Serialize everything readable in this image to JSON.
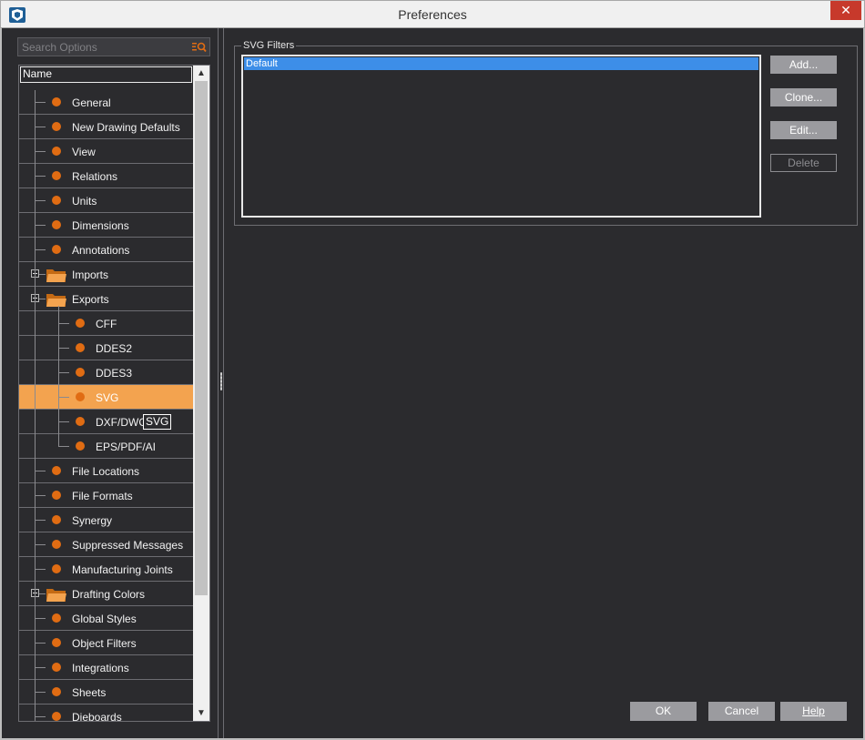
{
  "window": {
    "title": "Preferences",
    "close_glyph": "✕"
  },
  "search": {
    "placeholder": "Search Options"
  },
  "tree": {
    "header": "Name",
    "items": [
      {
        "label": "General",
        "level": 0,
        "type": "leaf"
      },
      {
        "label": "New Drawing Defaults",
        "level": 0,
        "type": "leaf"
      },
      {
        "label": "View",
        "level": 0,
        "type": "leaf"
      },
      {
        "label": "Relations",
        "level": 0,
        "type": "leaf"
      },
      {
        "label": "Units",
        "level": 0,
        "type": "leaf"
      },
      {
        "label": "Dimensions",
        "level": 0,
        "type": "leaf"
      },
      {
        "label": "Annotations",
        "level": 0,
        "type": "leaf"
      },
      {
        "label": "Imports",
        "level": 0,
        "type": "folder",
        "expanded": false
      },
      {
        "label": "Exports",
        "level": 0,
        "type": "folder",
        "expanded": true
      },
      {
        "label": "CFF",
        "level": 1,
        "type": "leaf"
      },
      {
        "label": "DDES2",
        "level": 1,
        "type": "leaf"
      },
      {
        "label": "DDES3",
        "level": 1,
        "type": "leaf"
      },
      {
        "label": "SVG",
        "level": 1,
        "type": "leaf",
        "selected": true
      },
      {
        "label": "DXF/DWG",
        "level": 1,
        "type": "leaf"
      },
      {
        "label": "EPS/PDF/AI",
        "level": 1,
        "type": "leaf"
      },
      {
        "label": "File Locations",
        "level": 0,
        "type": "leaf"
      },
      {
        "label": "File Formats",
        "level": 0,
        "type": "leaf"
      },
      {
        "label": "Synergy",
        "level": 0,
        "type": "leaf"
      },
      {
        "label": "Suppressed Messages",
        "level": 0,
        "type": "leaf"
      },
      {
        "label": "Manufacturing Joints",
        "level": 0,
        "type": "leaf"
      },
      {
        "label": "Drafting Colors",
        "level": 0,
        "type": "folder",
        "expanded": false
      },
      {
        "label": "Global Styles",
        "level": 0,
        "type": "leaf"
      },
      {
        "label": "Object Filters",
        "level": 0,
        "type": "leaf"
      },
      {
        "label": "Integrations",
        "level": 0,
        "type": "leaf"
      },
      {
        "label": "Sheets",
        "level": 0,
        "type": "leaf"
      },
      {
        "label": "Dieboards",
        "level": 0,
        "type": "leaf"
      }
    ],
    "tooltip": "SVG"
  },
  "svg_filters": {
    "group_label": "SVG Filters",
    "items": [
      "Default"
    ],
    "buttons": {
      "add": "Add...",
      "clone": "Clone...",
      "edit": "Edit...",
      "delete": "Delete"
    }
  },
  "footer": {
    "ok": "OK",
    "cancel": "Cancel",
    "help": "Help"
  },
  "colors": {
    "background": "#2b2b2e",
    "accent_orange": "#e06c13",
    "selection_orange": "#f3a34f",
    "list_selection_blue": "#3d8ee8",
    "close_red": "#c7392b"
  },
  "icons": {
    "app": "app-logo-icon",
    "search": "search-filter-icon",
    "leaf": "orange-dot-icon",
    "folder": "folder-icon",
    "expand": "plus-box-icon",
    "collapse": "minus-box-icon",
    "scroll_up": "chevron-up-icon",
    "scroll_down": "chevron-down-icon"
  }
}
